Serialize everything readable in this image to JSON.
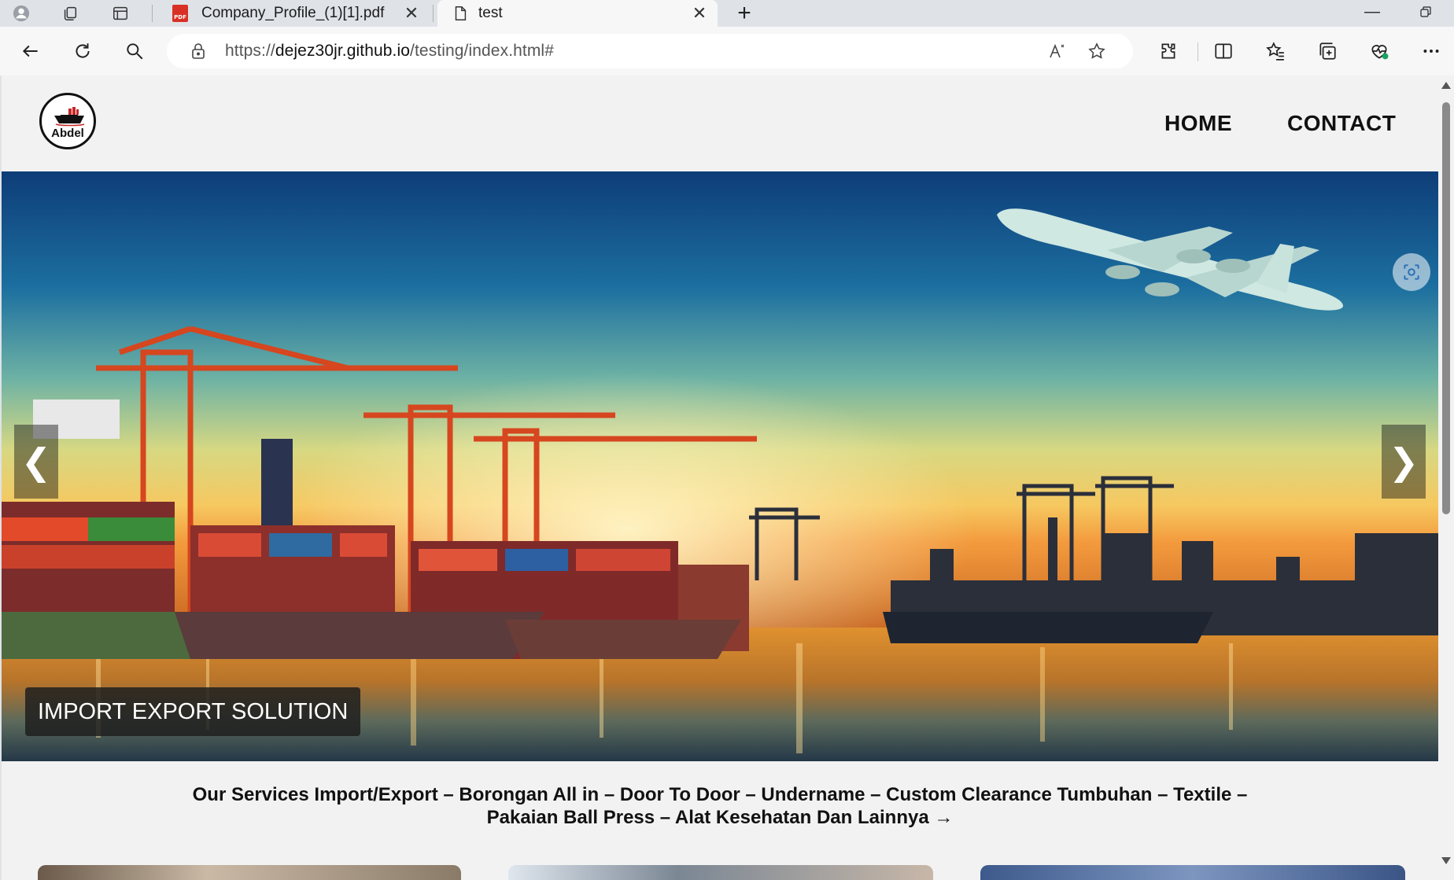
{
  "browser": {
    "tabs": [
      {
        "title": "Company_Profile_(1)[1].pdf",
        "favicon": "pdf-icon",
        "badge": "PDF",
        "active": false
      },
      {
        "title": "test",
        "favicon": "page-icon",
        "active": true
      }
    ],
    "url": {
      "scheme": "https://",
      "host": "dejez30jr.github.io",
      "path": "/testing/index.html#"
    }
  },
  "site": {
    "logo_text": "Abdel",
    "nav": [
      {
        "label": "HOME"
      },
      {
        "label": "CONTACT"
      }
    ],
    "hero": {
      "caption": "IMPORT EXPORT SOLUTION",
      "prev_arrow": "❮",
      "next_arrow": "❯"
    },
    "services": {
      "line1": "Our Services Import/Export – Borongan All in – Door To Door – Undername – Custom Clearance Tumbuhan – Textile –",
      "line2": "Pakaian Ball Press – Alat Kesehatan Dan Lainnya →"
    }
  },
  "colors": {
    "browser_chrome": "#dfe3e8",
    "toolbar": "#f7f7f7",
    "page_bg": "#f2f2f2",
    "text": "#111111",
    "caption_bg": "#1e1e1e"
  }
}
